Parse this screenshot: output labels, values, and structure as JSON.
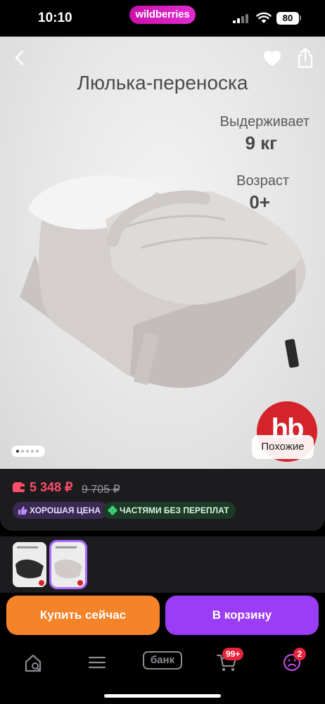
{
  "status_bar": {
    "time": "10:10",
    "brand": "wildberries",
    "battery": "80"
  },
  "hero": {
    "title": "Люлька-переноска",
    "spec_load_label": "Выдерживает",
    "spec_load_value": "9 кг",
    "spec_age_label": "Возраст",
    "spec_age_value": "0+",
    "logo_text": "hb",
    "similar_label": "Похожие",
    "carousel_dots": 5,
    "carousel_active": 1
  },
  "price": {
    "current": "5 348 ₽",
    "old": "9 705 ₽",
    "badges": [
      "ХОРОШАЯ ЦЕНА",
      "ЧАСТЯМИ БЕЗ ПЕРЕПЛАТ"
    ]
  },
  "thumbnails": {
    "count": 2,
    "selected": 2
  },
  "buttons": {
    "buy_now": "Купить сейчас",
    "add_to_cart": "В корзину"
  },
  "bottom_nav": {
    "items": [
      "home-search-icon",
      "menu-icon",
      "bank-icon",
      "cart-icon",
      "profile-icon"
    ],
    "bank_label": "банк",
    "cart_badge": "99+",
    "profile_badge": "2"
  },
  "colors": {
    "brand": "#cb11ab",
    "price": "#ff4d6a",
    "buy_now": "#f5832a",
    "add_to_cart": "#9b3cf7",
    "badge_red": "#e8243d"
  }
}
